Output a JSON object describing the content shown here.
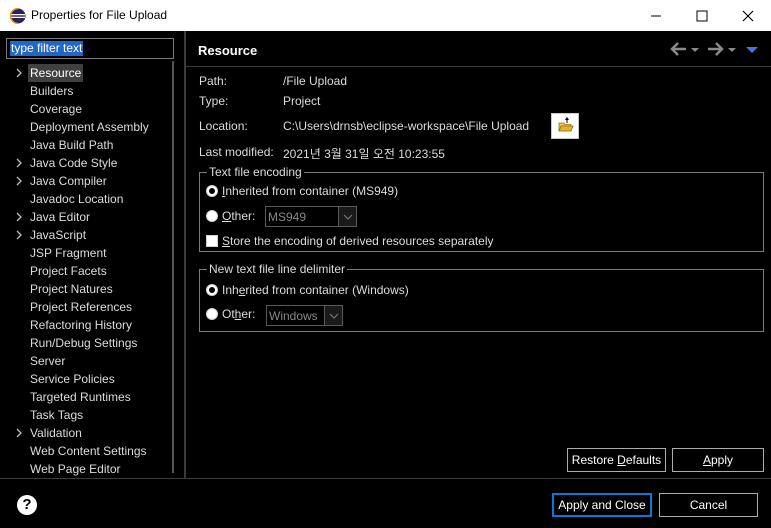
{
  "window": {
    "title": "Properties for File Upload",
    "icon": "eclipse-icon",
    "controls": [
      "minimize-icon",
      "maximize-icon",
      "close-icon"
    ]
  },
  "filter": {
    "placeholder": "type filter text"
  },
  "tree": {
    "items": [
      {
        "label": "Resource",
        "expandable": true,
        "selected": true
      },
      {
        "label": "Builders",
        "expandable": false
      },
      {
        "label": "Coverage",
        "expandable": false
      },
      {
        "label": "Deployment Assembly",
        "expandable": false
      },
      {
        "label": "Java Build Path",
        "expandable": false
      },
      {
        "label": "Java Code Style",
        "expandable": true
      },
      {
        "label": "Java Compiler",
        "expandable": true
      },
      {
        "label": "Javadoc Location",
        "expandable": false
      },
      {
        "label": "Java Editor",
        "expandable": true
      },
      {
        "label": "JavaScript",
        "expandable": true
      },
      {
        "label": "JSP Fragment",
        "expandable": false
      },
      {
        "label": "Project Facets",
        "expandable": false
      },
      {
        "label": "Project Natures",
        "expandable": false
      },
      {
        "label": "Project References",
        "expandable": false
      },
      {
        "label": "Refactoring History",
        "expandable": false
      },
      {
        "label": "Run/Debug Settings",
        "expandable": false
      },
      {
        "label": "Server",
        "expandable": false
      },
      {
        "label": "Service Policies",
        "expandable": false
      },
      {
        "label": "Targeted Runtimes",
        "expandable": false
      },
      {
        "label": "Task Tags",
        "expandable": false
      },
      {
        "label": "Validation",
        "expandable": true
      },
      {
        "label": "Web Content Settings",
        "expandable": false
      },
      {
        "label": "Web Page Editor",
        "expandable": false
      }
    ]
  },
  "page": {
    "title": "Resource",
    "nav_icons": [
      "back-arrow-icon",
      "forward-arrow-icon",
      "view-menu-icon"
    ],
    "path_label": "Path:",
    "path_value": "/File Upload",
    "type_label": "Type:",
    "type_value": "Project",
    "location_label": "Location:",
    "location_value": "C:\\Users\\drnsb\\eclipse-workspace\\File Upload",
    "modified_label": "Last modified:",
    "modified_value": "2021년 3월 31일 오전 10:23:55"
  },
  "encoding": {
    "legend": "Text file encoding",
    "inherited_prefix": "I",
    "inherited_rest": "nherited from container (MS949)",
    "other_prefix": "O",
    "other_rest": "ther:",
    "other_value": "MS949",
    "store_prefix": "S",
    "store_rest": "tore the encoding of derived resources separately",
    "inherited_checked": true,
    "store_checked": false
  },
  "delimiter": {
    "legend": "New text file line delimiter",
    "inherited_prefix": "Inh",
    "inherited_u": "e",
    "inherited_rest": "rited from container (Windows)",
    "other_prefix": "Ot",
    "other_u": "h",
    "other_rest": "er:",
    "other_value": "Windows",
    "inherited_checked": true
  },
  "buttons": {
    "restore_prefix": "Restore ",
    "restore_u": "D",
    "restore_rest": "efaults",
    "apply": "Apply",
    "apply_u": "A",
    "apply_rest": "pply",
    "apply_close": "Apply and Close",
    "cancel": "Cancel"
  },
  "colors": {
    "accent": "#0a78d7",
    "selection": "#1f67c8",
    "background": "#000000"
  }
}
